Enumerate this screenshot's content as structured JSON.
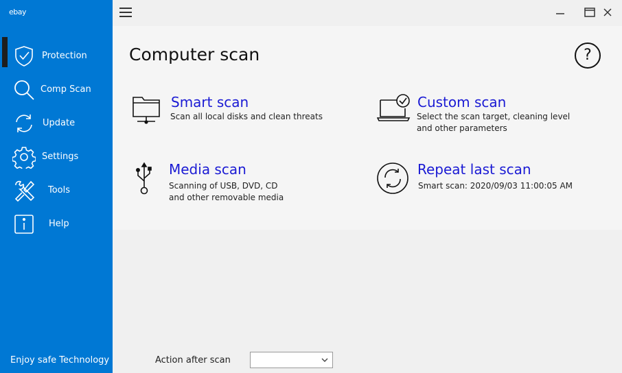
{
  "app": {
    "brand": "ebay",
    "tagline": "Enjoy safe Technology"
  },
  "nav": [
    {
      "label": "Protection",
      "icon": "shield-check-icon"
    },
    {
      "label": "Comp Scan",
      "icon": "search-icon"
    },
    {
      "label": "Update",
      "icon": "refresh-icon"
    },
    {
      "label": "Settings",
      "icon": "gear-icon"
    },
    {
      "label": "Tools",
      "icon": "tools-icon"
    },
    {
      "label": "Help",
      "icon": "info-icon"
    }
  ],
  "nav_active": "Comp Scan",
  "main": {
    "title": "Computer scan",
    "help_symbol": "?",
    "options": {
      "smart": {
        "title": "Smart scan",
        "desc1": "Scan all local disks and clean threats",
        "desc2": "",
        "icon": "network-folder-icon"
      },
      "custom": {
        "title": "Custom scan",
        "desc1": "Select the scan target, cleaning level",
        "desc2": "and other parameters",
        "icon": "laptop-check-icon"
      },
      "media": {
        "title": "Media scan",
        "desc1": "Scanning of USB, DVD, CD",
        "desc2": "and other removable media",
        "icon": "usb-icon"
      },
      "repeat": {
        "title": "Repeat last scan",
        "desc1": "Smart scan: 2020/09/03 11:00:05 AM",
        "desc2": "",
        "icon": "repeat-icon"
      }
    }
  },
  "footer": {
    "action_label": "Action after scan",
    "action_value": ""
  },
  "colors": {
    "sidebar": "#0078d4",
    "link": "#1a1ad4",
    "panel": "#f5f5f5",
    "background": "#f0f0f0"
  }
}
